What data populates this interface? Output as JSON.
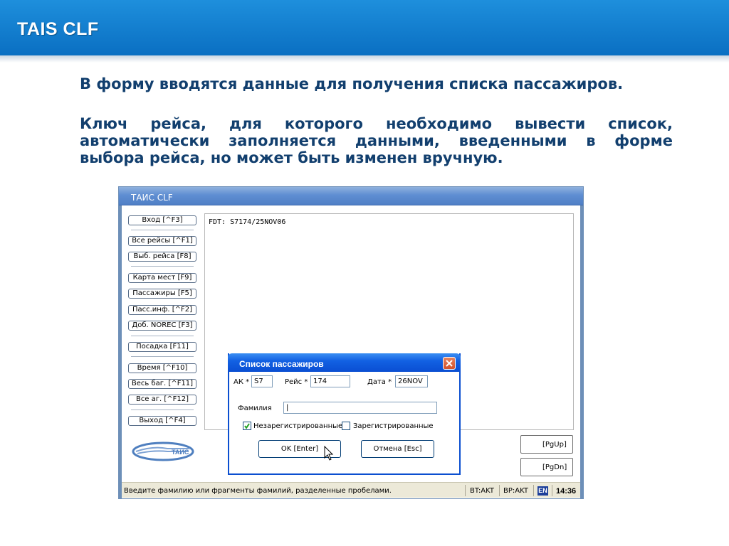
{
  "slide": {
    "title": "TAIS CLF",
    "paragraph1": "В форму вводятся данные для получения списка пассажиров.",
    "paragraph2": "Ключ рейса, для которого необходимо вывести список, автоматически заполняется данными, введенными в форме выбора рейса, но может быть изменен вручную."
  },
  "app": {
    "title": "ТАИС CLF",
    "menu": [
      {
        "label": "Вход [^F3]"
      },
      {
        "label": "Все рейсы [^F1]"
      },
      {
        "label": "Выб. рейса [F8]"
      },
      {
        "label": "Карта мест [F9]"
      },
      {
        "label": "Пассажиры [F5]"
      },
      {
        "label": "Пасс.инф. [^F2]"
      },
      {
        "label": "Доб. NOREC [F3]"
      },
      {
        "label": "Посадка [F11]"
      },
      {
        "label": "Время [^F10]"
      },
      {
        "label": "Весь баг. [^F11]"
      },
      {
        "label": "Все аг. [^F12]"
      },
      {
        "label": "Выход [^F4]"
      }
    ],
    "main_text": "FDT: S7174/25NOV06",
    "page_up_label": "[PgUp]",
    "page_down_label": "[PgDn]",
    "logo_text": "ТАИС",
    "status": {
      "message": "Введите фамилию или фрагменты фамилий, разделенные пробелами.",
      "bt": "BT:AKT",
      "bp": "BP:AKT",
      "lang": "EN",
      "clock": "14:36"
    }
  },
  "dialog": {
    "title": "Список пассажиров",
    "airline_label": "АК *",
    "airline_value": "S7",
    "flight_label": "Рейс *",
    "flight_value": "174",
    "date_label": "Дата *",
    "date_value": "26NOV",
    "surname_label": "Фамилия",
    "surname_value": "|",
    "unregistered_label": "Незарегистрированные",
    "unregistered_checked": true,
    "registered_label": "Зарегистрированные",
    "registered_checked": false,
    "ok_label": "OK  [Enter]",
    "cancel_label": "Отмена  [Esc]"
  },
  "colors": {
    "header_blue": "#0a6fc2",
    "text_blue": "#123f6e",
    "dialog_blue": "#0a4ed2"
  }
}
